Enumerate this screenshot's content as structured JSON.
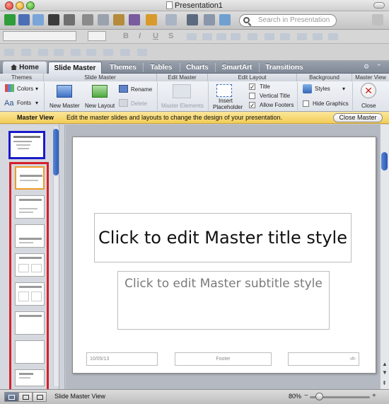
{
  "window": {
    "title": "Presentation1"
  },
  "search": {
    "placeholder": "Search in Presentation"
  },
  "tabs": [
    "Home",
    "Slide Master",
    "Themes",
    "Tables",
    "Charts",
    "SmartArt",
    "Transitions"
  ],
  "ribbon": {
    "groups": [
      "Themes",
      "Slide Master",
      "Edit Master",
      "Edit Layout",
      "Background",
      "Master View"
    ],
    "themes_colors": "Colors",
    "themes_fonts": "Fonts",
    "new_master": "New Master",
    "new_layout": "New Layout",
    "rename": "Rename",
    "delete": "Delete",
    "master_elements": "Master Elements",
    "insert_placeholder_1": "Insert",
    "insert_placeholder_2": "Placeholder",
    "title_check": "Title",
    "vertical_title_check": "Vertical Title",
    "allow_footers_check": "Allow Footers",
    "styles": "Styles",
    "hide_graphics": "Hide Graphics",
    "close": "Close"
  },
  "message_bar": {
    "title": "Master View",
    "text": "Edit the master slides and layouts to change the design of your presentation.",
    "button": "Close Master"
  },
  "slide": {
    "title_placeholder": "Click to edit Master title style",
    "subtitle_placeholder": "Click to edit Master subtitle style",
    "date": "10/05/13",
    "footer": "Footer",
    "page_number": "‹#›"
  },
  "status": {
    "view_label": "Slide Master View",
    "zoom": "80%"
  },
  "colors": {
    "master_highlight": "#1a1acb",
    "layouts_highlight": "#d4212a",
    "message_bar": "#f4d365"
  }
}
